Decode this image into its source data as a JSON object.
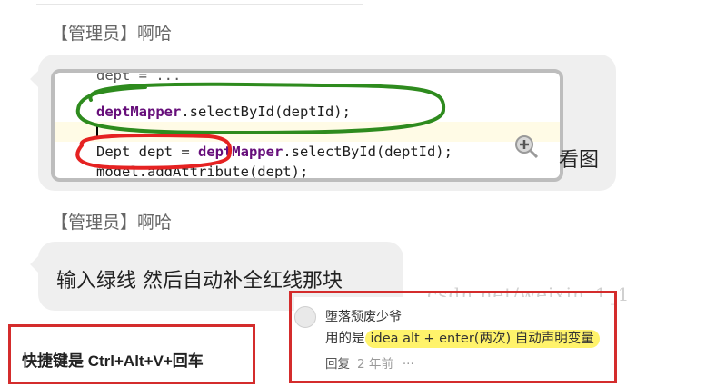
{
  "messages": [
    {
      "sender": "【管理员】啊哈",
      "image": {
        "code_lines": {
          "line_green_kw": "deptMapper",
          "line_green_rest": ".selectById(deptId);",
          "line_red_prefix": "Dept dept = ",
          "line_red_kw": "deptMapper",
          "line_red_rest": ".selectById(deptId);",
          "line_bottom": "model.addAttribute(dept);"
        }
      },
      "caption": "看图"
    },
    {
      "sender": "【管理员】啊哈",
      "text": "输入绿线 然后自动补全红线那块"
    }
  ],
  "shortcut_note": "快捷键是 Ctrl+Alt+V+回车",
  "watermark": "csdn.net/weixin_1_1",
  "comment": {
    "username": "堕落颓废少爷",
    "body_prefix": "用的是",
    "body_highlight": "idea alt + enter(两次) 自动声明变量",
    "reply_label": "回复",
    "time": "2 年前",
    "more": "···"
  },
  "colors": {
    "bubble": "#efefef",
    "green_annotation": "#2e8b1e",
    "red_annotation": "#e52222",
    "red_box": "#d42c2c",
    "highlight": "#fff36b",
    "keyword": "#660e7a"
  }
}
